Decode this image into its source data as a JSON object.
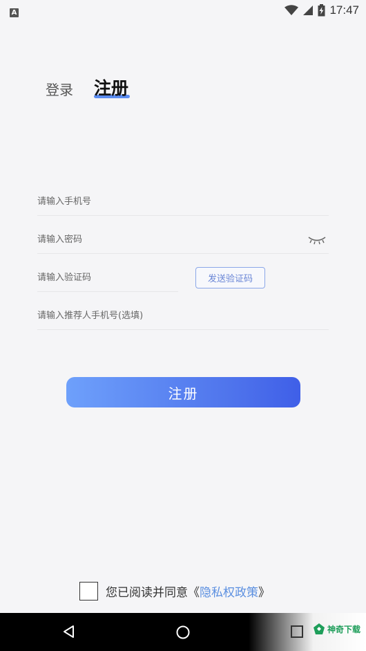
{
  "status_bar": {
    "notification_letter": "A",
    "icons": [
      "wifi-icon",
      "signal-icon",
      "battery-charging-icon"
    ],
    "time": "17:47"
  },
  "tabs": {
    "login": "登录",
    "register": "注册",
    "active": "register",
    "accent_color": "#5b8cf0"
  },
  "form": {
    "phone_placeholder": "请输入手机号",
    "password_placeholder": "请输入密码",
    "code_placeholder": "请输入验证码",
    "send_code_label": "发送验证码",
    "referrer_placeholder": "请输入推荐人手机号(选填)",
    "password_toggle_icon": "eye-closed-icon"
  },
  "submit": {
    "label": "注册",
    "gradient": [
      "#6ea0fb",
      "#3f5fe8"
    ]
  },
  "agreement": {
    "checked": false,
    "text": "您已阅读并同意",
    "open_bracket": "《",
    "link": "隐私权政策",
    "close_bracket": "》",
    "link_color": "#5b8fe0"
  },
  "nav_bar": {
    "buttons": [
      "back-icon",
      "home-icon",
      "recent-apps-icon"
    ],
    "watermark": "神奇下载"
  }
}
